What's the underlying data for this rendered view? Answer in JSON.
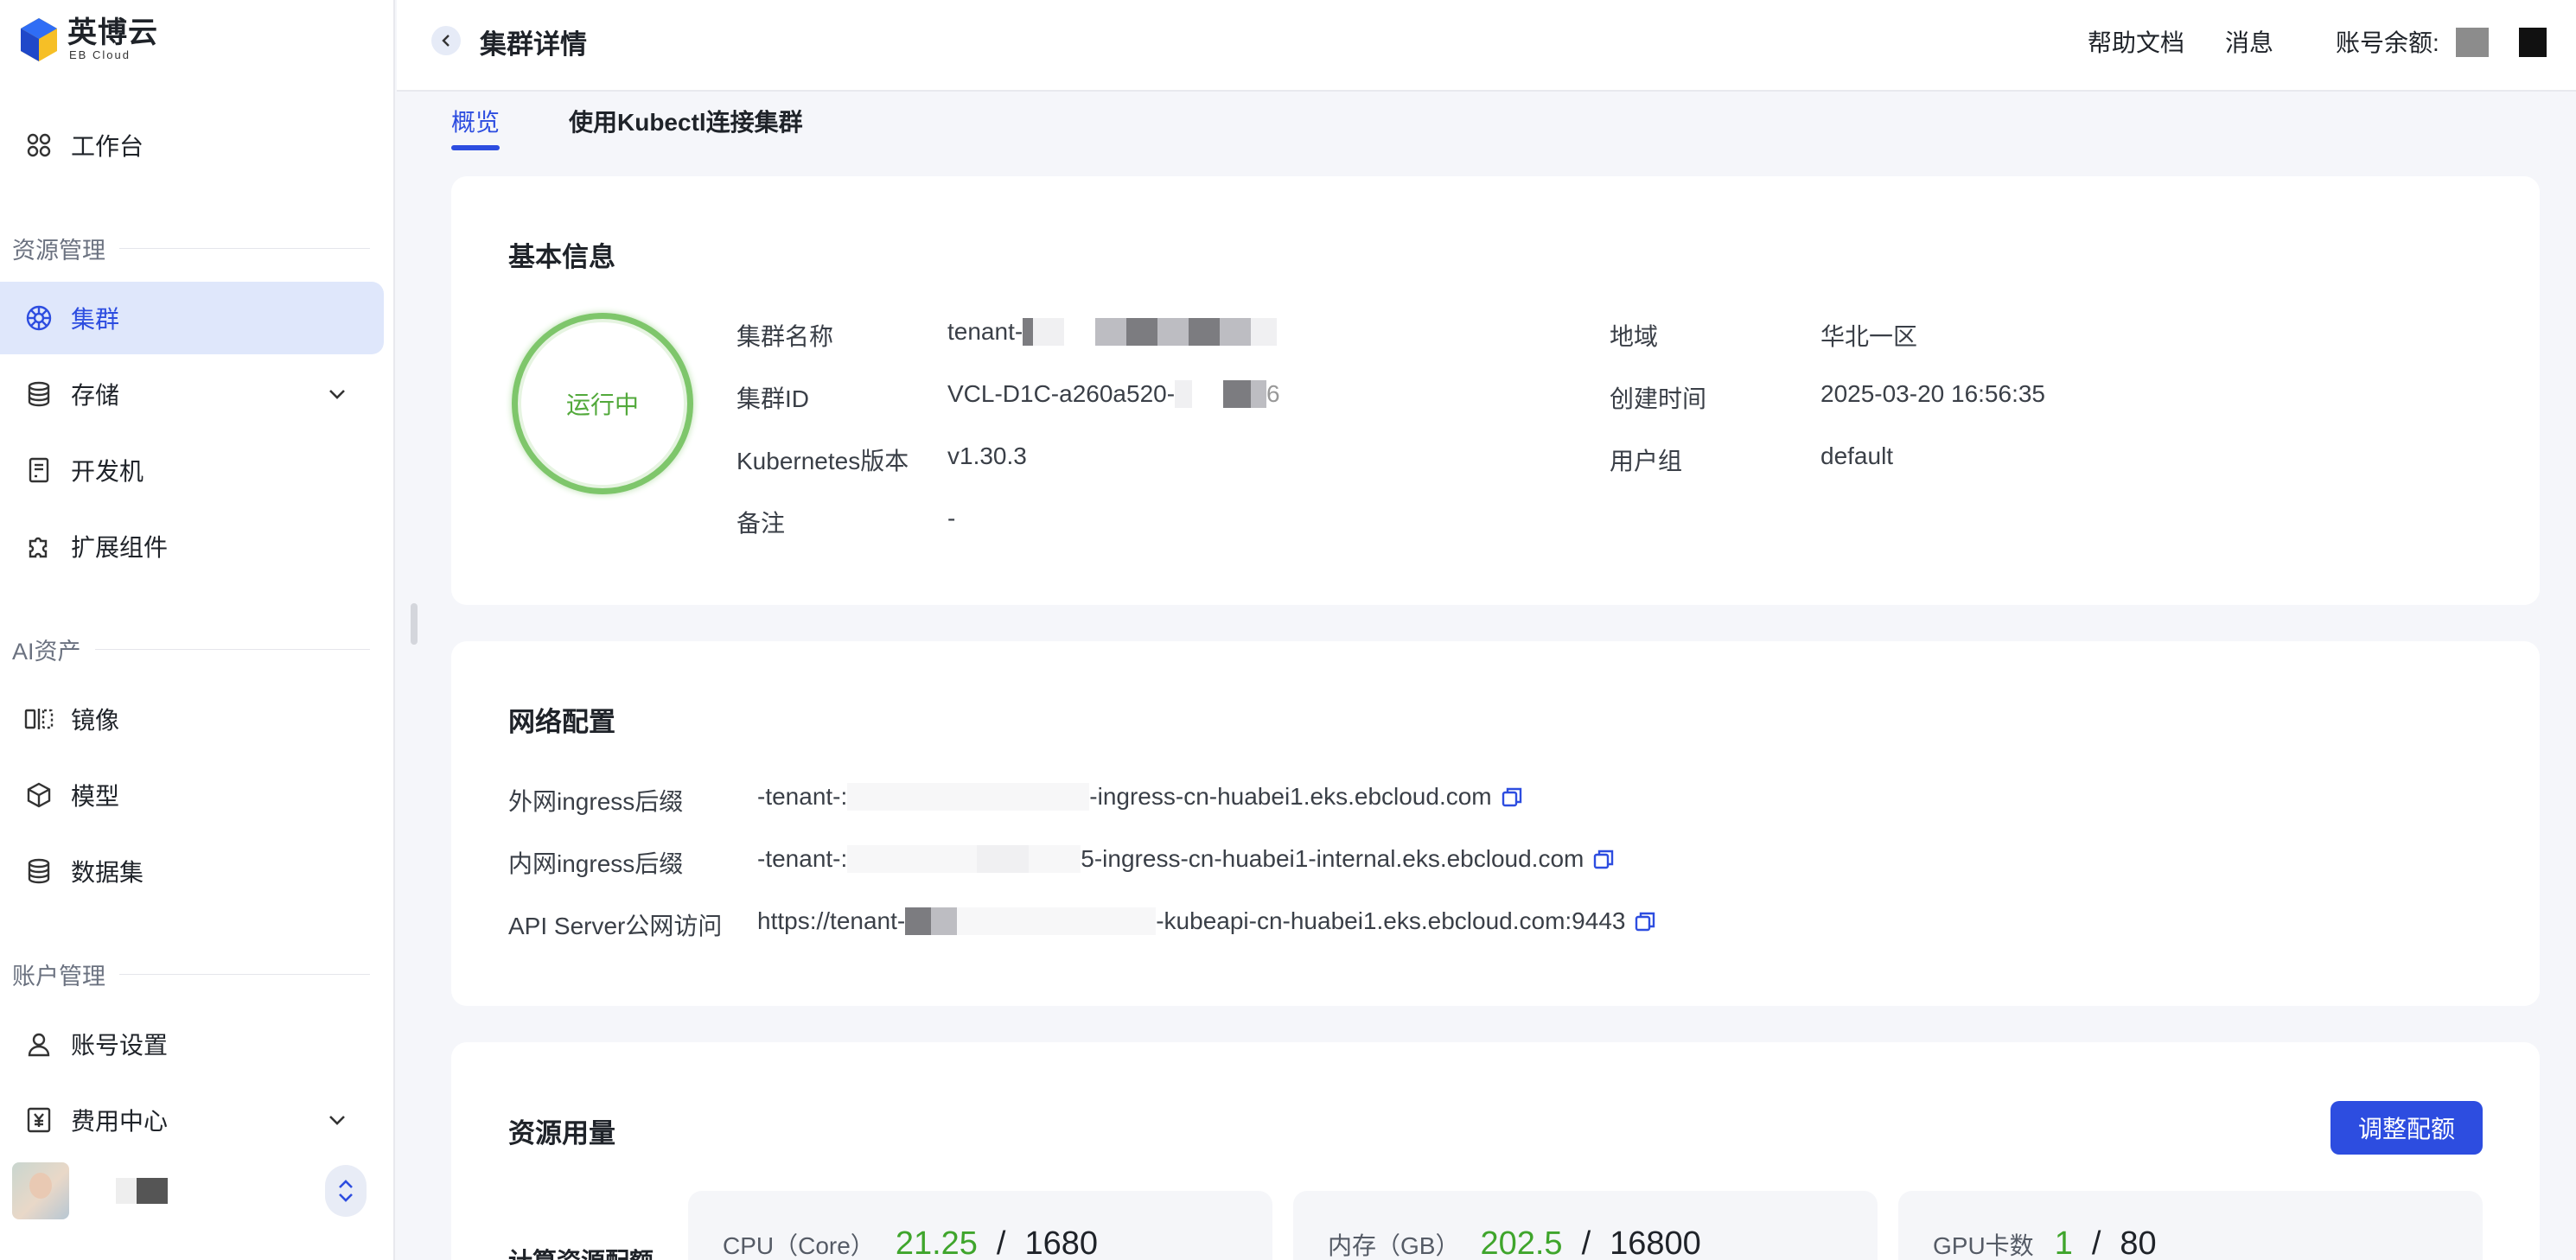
{
  "brand": {
    "name_cn": "英博云",
    "name_en": "EB Cloud"
  },
  "sidebar": {
    "workbench": "工作台",
    "sections": {
      "resource": "资源管理",
      "ai": "AI资产",
      "account": "账户管理"
    },
    "items": {
      "cluster": "集群",
      "storage": "存储",
      "devbox": "开发机",
      "extensions": "扩展组件",
      "image": "镜像",
      "model": "模型",
      "dataset": "数据集",
      "account_settings": "账号设置",
      "billing": "费用中心"
    }
  },
  "header": {
    "title": "集群详情",
    "help": "帮助文档",
    "messages": "消息",
    "balance_label": "账号余额:"
  },
  "tabs": {
    "overview": "概览",
    "kubectl": "使用Kubectl连接集群"
  },
  "basic_info": {
    "title": "基本信息",
    "status": "运行中",
    "fields": {
      "name_label": "集群名称",
      "name_value": "tenant-",
      "id_label": "集群ID",
      "id_value": "VCL-D1C-a260a520-",
      "id_suffix": "6",
      "k8s_label": "Kubernetes版本",
      "k8s_value": "v1.30.3",
      "note_label": "备注",
      "note_value": "-",
      "region_label": "地域",
      "region_value": "华北一区",
      "created_label": "创建时间",
      "created_value": "2025-03-20 16:56:35",
      "group_label": "用户组",
      "group_value": "default"
    }
  },
  "network": {
    "title": "网络配置",
    "rows": [
      {
        "label": "外网ingress后缀",
        "prefix": "-tenant-:",
        "suffix": "-ingress-cn-huabei1.eks.ebcloud.com"
      },
      {
        "label": "内网ingress后缀",
        "prefix": "-tenant-:",
        "suffix": "5-ingress-cn-huabei1-internal.eks.ebcloud.com"
      },
      {
        "label": "API Server公网访问",
        "prefix": "https://tenant-",
        "suffix": "-kubeapi-cn-huabei1.eks.ebcloud.com:9443"
      }
    ]
  },
  "resources": {
    "title": "资源用量",
    "adjust_button": "调整配额",
    "quota_label": "计算资源配额",
    "quotas": [
      {
        "name": "CPU（Core）",
        "used": "21.25",
        "sep": "/",
        "total": "1680"
      },
      {
        "name": "内存（GB）",
        "used": "202.5",
        "sep": "/",
        "total": "16800"
      },
      {
        "name": "GPU卡数",
        "used": "1",
        "sep": "/",
        "total": "80"
      }
    ]
  },
  "colors": {
    "primary": "#2d4de0",
    "success": "#52a93b",
    "nav_active_bg": "#dfe7fb"
  },
  "icons": {
    "workbench": "grid-icon",
    "cluster": "helm-wheel-icon",
    "storage": "database-icon",
    "devbox": "device-icon",
    "extensions": "puzzle-icon",
    "image": "mirror-icon",
    "model": "cube-icon",
    "dataset": "database-icon",
    "account_settings": "user-icon",
    "billing": "yen-icon",
    "copy": "copy-icon"
  }
}
